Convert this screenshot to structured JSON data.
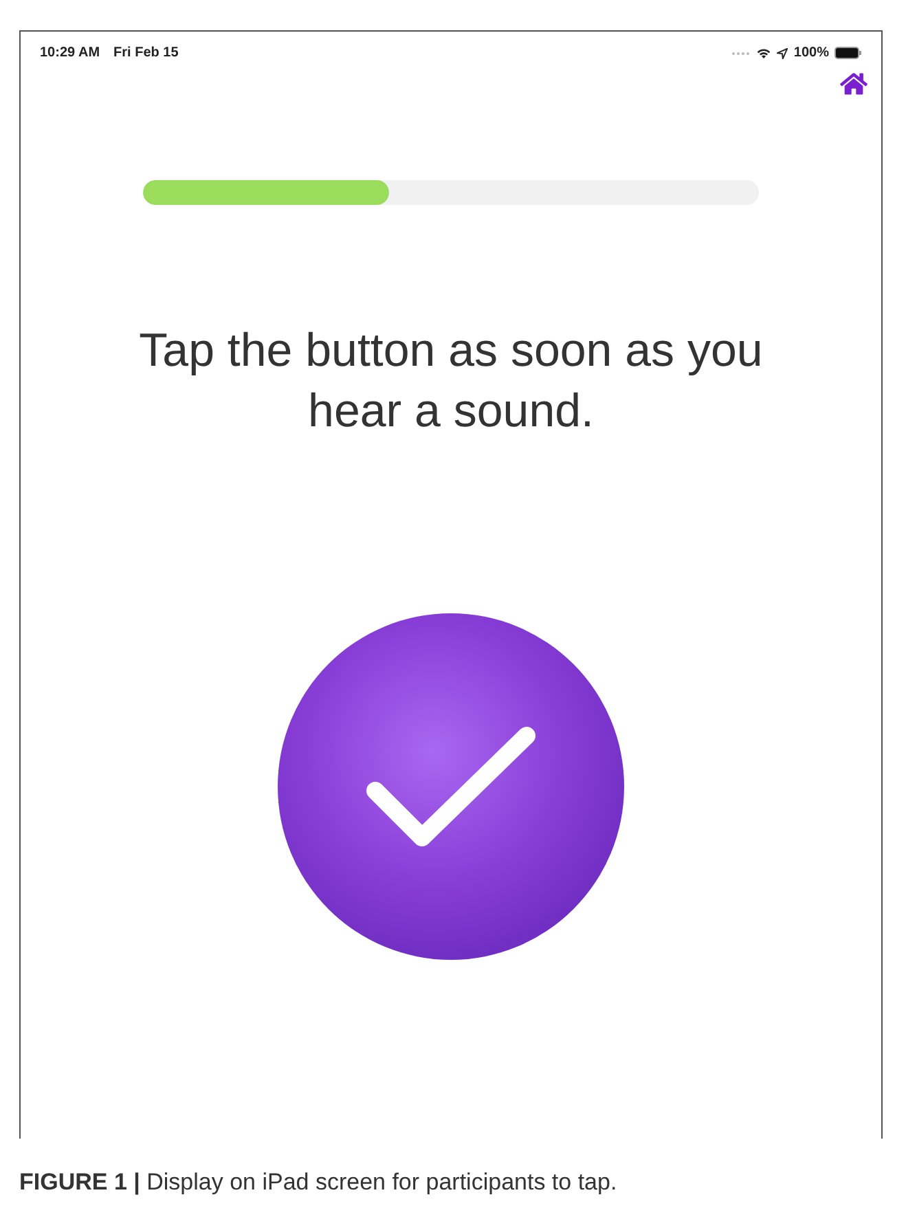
{
  "status_bar": {
    "time": "10:29 AM",
    "date": "Fri Feb 15",
    "battery": "100%"
  },
  "progress": {
    "level": 0.4
  },
  "instruction": "Tap the button as soon as you hear a sound.",
  "caption": "**FIGURE 1 |** Display on iPad screen for participants to tap."
}
